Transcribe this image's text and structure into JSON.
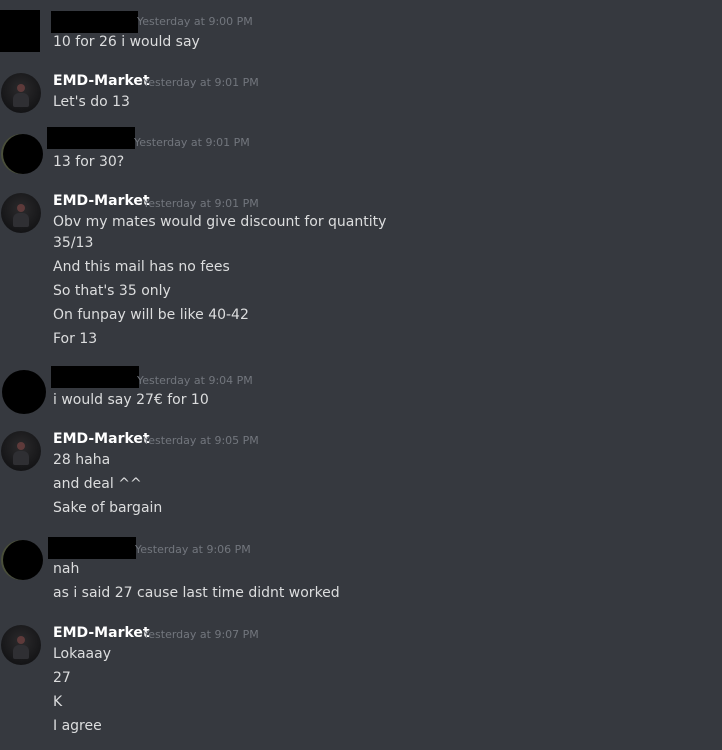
{
  "messages": [
    {
      "author": "",
      "timestamp": "Yesterday at 9:00 PM",
      "lines": [
        "10 for 26 i would say"
      ]
    },
    {
      "author": "EMD-Market",
      "timestamp": "Yesterday at 9:01 PM",
      "lines": [
        "Let's do 13"
      ]
    },
    {
      "author": "",
      "timestamp": "Yesterday at 9:01 PM",
      "lines": [
        "13 for 30?"
      ]
    },
    {
      "author": "EMD-Market",
      "timestamp": "Yesterday at 9:01 PM",
      "lines": [
        "Obv my mates would give discount for quantity",
        "35/13",
        "And this mail has no fees",
        "So that's 35 only",
        "On funpay will be like 40-42",
        "For 13"
      ]
    },
    {
      "author": "",
      "timestamp": "Yesterday at 9:04 PM",
      "lines": [
        "i would say 27€ for 10"
      ]
    },
    {
      "author": "EMD-Market",
      "timestamp": "Yesterday at 9:05 PM",
      "lines": [
        "28 haha",
        "and deal ^^",
        "Sake of bargain"
      ]
    },
    {
      "author": "",
      "timestamp": "Yesterday at 9:06 PM",
      "lines": [
        "nah",
        "as i said 27 cause last time didnt worked"
      ]
    },
    {
      "author": "EMD-Market",
      "timestamp": "Yesterday at 9:07 PM",
      "lines": [
        "Lokaaay",
        "27",
        "K",
        "I agree"
      ]
    }
  ],
  "colors": {
    "background": "#36393f",
    "text": "#dcddde",
    "username": "#ffffff",
    "timestamp": "#72767d",
    "redaction": "#000000"
  }
}
